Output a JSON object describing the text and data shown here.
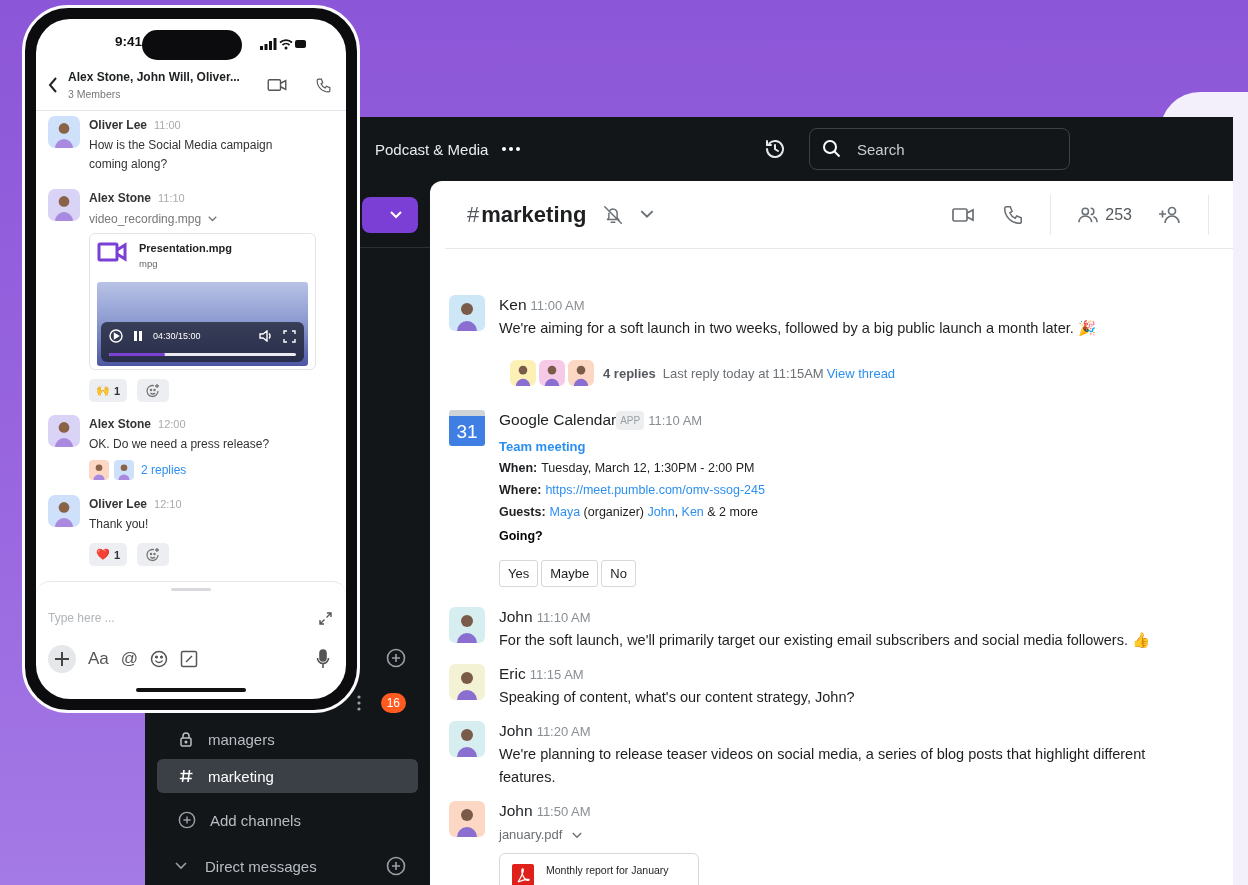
{
  "app": {
    "workspace": "Podcast & Media",
    "search": {
      "placeholder": "Search"
    },
    "sidebar": {
      "unread_badge": "16",
      "channels": [
        {
          "kind": "private",
          "name": "managers",
          "selected": false
        },
        {
          "kind": "public",
          "name": "marketing",
          "selected": true
        }
      ],
      "add_channels": "Add channels",
      "direct_messages": "Direct messages"
    },
    "channel": {
      "prefix": "#",
      "name": "marketing",
      "member_count": "253"
    },
    "messages": [
      {
        "kind": "message",
        "author": "Ken",
        "time": "11:00 AM",
        "color": "#cde7f7",
        "lines": [
          "We're aiming for a soft launch in two weeks, followed by a big public launch a month later. 🎉"
        ],
        "thread": {
          "avatars": [
            {
              "color": "#fdf0b5"
            },
            {
              "color": "#f6c9e6"
            },
            {
              "color": "#fbd7c4"
            }
          ],
          "replies": "4 replies",
          "last_reply": "Last reply today at 11:15AM",
          "link": "View thread"
        }
      },
      {
        "kind": "app",
        "author": "Google Calendar",
        "badge": "APP",
        "time": "11:10 AM",
        "icon_label": "31",
        "event": {
          "title": "Team meeting",
          "details": [
            {
              "label": "When:",
              "parts": [
                {
                  "kind": "text",
                  "text": "Tuesday, March 12, 1:30PM - 2:00 PM"
                }
              ]
            },
            {
              "label": "Where:",
              "parts": [
                {
                  "kind": "link",
                  "text": "https://meet.pumble.com/omv-ssog-245"
                }
              ]
            },
            {
              "label": "Guests:",
              "parts": [
                {
                  "kind": "link",
                  "text": "Maya"
                },
                {
                  "kind": "text",
                  "text": " (organizer) "
                },
                {
                  "kind": "link",
                  "text": "John"
                },
                {
                  "kind": "text",
                  "text": ", "
                },
                {
                  "kind": "link",
                  "text": "Ken"
                },
                {
                  "kind": "text",
                  "text": " & 2 more"
                }
              ]
            }
          ],
          "question": "Going?",
          "options": [
            "Yes",
            "Maybe",
            "No"
          ]
        }
      },
      {
        "kind": "message",
        "author": "John",
        "time": "11:10 AM",
        "color": "#d7eef0",
        "lines": [
          "For the soft launch, we'll primarily target our existing email subscribers and social media followers. 👍"
        ]
      },
      {
        "kind": "message",
        "author": "Eric",
        "time": "11:15 AM",
        "color": "#f3f2d5",
        "lines": [
          "Speaking of content, what's our content strategy, John?"
        ]
      },
      {
        "kind": "message",
        "author": "John",
        "time": "11:20 AM",
        "color": "#d7eef0",
        "lines": [
          "We're planning to release teaser videos on social media, a series of blog posts that highlight different",
          "features."
        ]
      },
      {
        "kind": "message",
        "author": "John",
        "time": "11:50 AM",
        "color": "#fbd7c4",
        "file": {
          "name": "january.pdf",
          "title": "Monthly report for January"
        }
      }
    ]
  },
  "phone": {
    "status_bar": {
      "time": "9:41"
    },
    "header": {
      "title": "Alex Stone, John Will, Oliver...",
      "subtitle": "3 Members"
    },
    "messages": [
      {
        "author": "Oliver Lee",
        "time": "11:00",
        "color": "#cfe0fb",
        "text": "How is the Social Media campaign coming along?"
      },
      {
        "author": "Alex Stone",
        "time": "11:10",
        "color": "#d9d3f5",
        "file_name": "video_recording.mpg",
        "attachment": {
          "title": "Presentation.mpg",
          "type": "mpg",
          "time": "04:30/15:00",
          "level": 0.3
        },
        "reactions": [
          {
            "emoji": "🙌",
            "count": "1"
          }
        ]
      },
      {
        "author": "Alex Stone",
        "time": "12:00",
        "color": "#d9d3f5",
        "text": "OK. Do we need a press release?",
        "replies": "2 replies",
        "reply_avatars": [
          {
            "color": "#fbd7c4"
          },
          {
            "color": "#cfe0fb"
          }
        ]
      },
      {
        "author": "Oliver Lee",
        "time": "12:10",
        "color": "#cfe0fb",
        "text": "Thank you!",
        "reactions": [
          {
            "emoji": "❤️",
            "count": "1"
          }
        ]
      }
    ],
    "composer": {
      "placeholder": "Type here ...",
      "format_label": "Aa",
      "mention_label": "@"
    }
  }
}
